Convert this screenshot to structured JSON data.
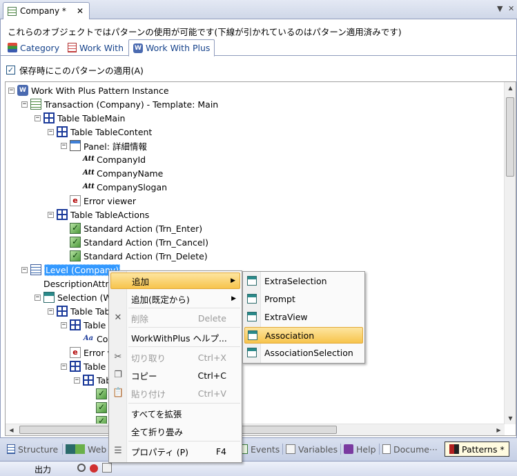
{
  "document_tab": {
    "title": "Company *",
    "close_label": "✕"
  },
  "strip_buttons": {
    "dropdown": "▼",
    "close": "✕"
  },
  "description": "これらのオブジェクトではパターンの使用が可能です(下線が引かれているのはパターン適用済みです)",
  "pattern_tabs": [
    {
      "label": "Category",
      "icon": "category-icon"
    },
    {
      "label": "Work With",
      "icon": "work-with-icon"
    },
    {
      "label": "Work With Plus",
      "icon": "work-with-plus-icon",
      "active": true
    }
  ],
  "apply_on_save": {
    "label": "保存時にこのパターンの適用(A)",
    "checked": true,
    "mark": "✓"
  },
  "tree": {
    "nodes": [
      {
        "label": "Work With Plus Pattern Instance",
        "icon": "wwp",
        "expander": "−"
      },
      {
        "label": "Transaction (Company) - Template: Main",
        "icon": "trn",
        "expander": "−"
      },
      {
        "label": "Table TableMain",
        "icon": "table",
        "expander": "−"
      },
      {
        "label": "Table TableContent",
        "icon": "table",
        "expander": "−"
      },
      {
        "label": "Panel: 詳細情報",
        "icon": "panel",
        "expander": "−"
      },
      {
        "label": "CompanyId",
        "icon": "attr"
      },
      {
        "label": "CompanyName",
        "icon": "attr"
      },
      {
        "label": "CompanySlogan",
        "icon": "attr"
      },
      {
        "label": "Error viewer",
        "icon": "error"
      },
      {
        "label": "Table TableActions",
        "icon": "table",
        "expander": "−"
      },
      {
        "label": "Standard Action (Trn_Enter)",
        "icon": "action"
      },
      {
        "label": "Standard Action (Trn_Cancel)",
        "icon": "action"
      },
      {
        "label": "Standard Action (Trn_Delete)",
        "icon": "action"
      },
      {
        "label": "Level (Company)",
        "icon": "level",
        "expander": "−",
        "selected": true
      },
      {
        "label": "DescriptionAttribute",
        "icon": "none"
      },
      {
        "label": "Selection (WorkWith)",
        "icon": "sel",
        "expander": "−"
      },
      {
        "label": "Table TableGrid",
        "icon": "table",
        "expander": "−"
      },
      {
        "label": "Table TableSearch",
        "icon": "table",
        "expander": "−"
      },
      {
        "label": "CompanyName",
        "icon": "attr2"
      },
      {
        "label": "Error viewer",
        "icon": "error"
      },
      {
        "label": "Table TableGrid",
        "icon": "table",
        "expander": "−"
      },
      {
        "label": "Table",
        "icon": "table",
        "expander": "−"
      },
      {
        "label": "",
        "icon": "action"
      },
      {
        "label": "",
        "icon": "action"
      },
      {
        "label": "",
        "icon": "action"
      }
    ]
  },
  "context_menu": {
    "items": [
      {
        "label": "追加",
        "shortcut": "",
        "submenu": true,
        "hover": true,
        "icon": ""
      },
      {
        "label": "追加(既定から)",
        "shortcut": "",
        "submenu": true,
        "icon": ""
      },
      {
        "label": "削除",
        "shortcut": "Delete",
        "disabled": true,
        "icon": "✕"
      },
      {
        "label": "WorkWithPlus ヘルプ...",
        "shortcut": "",
        "icon": ""
      },
      {
        "label": "切り取り",
        "shortcut": "Ctrl+X",
        "disabled": true,
        "icon": "✂"
      },
      {
        "label": "コピー",
        "shortcut": "Ctrl+C",
        "icon": "❐"
      },
      {
        "label": "貼り付け",
        "shortcut": "Ctrl+V",
        "disabled": true,
        "icon": "📋"
      },
      {
        "label": "すべてを拡張",
        "shortcut": "",
        "icon": ""
      },
      {
        "label": "全て折り畳み",
        "shortcut": "",
        "icon": ""
      },
      {
        "label": "プロパティ (P)",
        "shortcut": "F4",
        "icon": "☰"
      }
    ],
    "submenu_arrow": "▶"
  },
  "submenu": {
    "items": [
      {
        "label": "ExtraSelection"
      },
      {
        "label": "Prompt"
      },
      {
        "label": "ExtraView"
      },
      {
        "label": "Association",
        "hover": true
      },
      {
        "label": "AssociationSelection"
      }
    ]
  },
  "bottom_tabs": [
    {
      "label": "Structure",
      "icon": "structure-icon"
    },
    {
      "label": "Web",
      "icon": "web-form-icon"
    },
    {
      "label": "Events",
      "icon": "events-icon"
    },
    {
      "label": "Variables",
      "icon": "variables-icon"
    },
    {
      "label": "Help",
      "icon": "help-icon"
    },
    {
      "label": "Docume···",
      "icon": "documentation-icon"
    },
    {
      "label": "Patterns *",
      "icon": "patterns-icon",
      "active": true
    }
  ],
  "status_bar": {
    "output_label": "出力"
  },
  "scroll_arrows": {
    "up": "▲",
    "down": "▼",
    "left": "◀",
    "right": "▶"
  },
  "colors": {
    "selection": "#3399ff",
    "menu_hover": "#f7c44c",
    "tab_text": "#15428b"
  }
}
